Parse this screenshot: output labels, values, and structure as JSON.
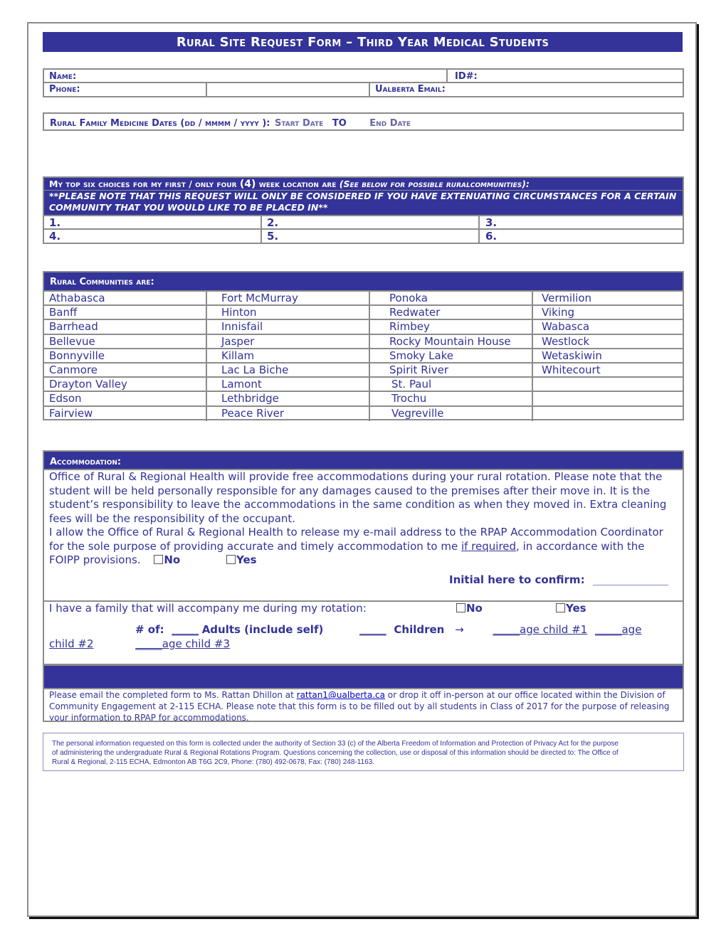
{
  "title": "Rural Site Request Form – Third Year Medical Students",
  "student_info": {
    "name_label": "Name:",
    "id_label": "ID#:",
    "phone_label": "Phone:",
    "email_label": "Ualberta Email:"
  },
  "dates": {
    "label": "Rural Family Medicine Dates (dd / mmmm / yyyy ):",
    "start_label": "Start Date",
    "to_label": "TO",
    "end_label": "End Date"
  },
  "choices": {
    "header_part1": "My top six choices for my first / only four",
    "header_num": "(4)",
    "header_part2": "week location are",
    "header_note": "(See below for possible ruralcommunities):",
    "note_line1": "**PLEASE NOTE THAT THIS REQUEST WILL ONLY BE CONSIDERED IF YOU HAVE EXTENUATING CIRCUMSTANCES FOR A CERTAIN",
    "note_line2": "COMMUNITY THAT YOU WOULD LIKE TO BE PLACED IN**",
    "slots": [
      "1.",
      "2.",
      "3.",
      "4.",
      "5.",
      "6."
    ]
  },
  "communities": {
    "header": "Rural Communities are:",
    "rows": [
      [
        "Athabasca",
        "Fort McMurray",
        "Ponoka",
        "Vermilion"
      ],
      [
        "Banff",
        "Hinton",
        "Redwater",
        "Viking"
      ],
      [
        "Barrhead",
        "Innisfail",
        "Rimbey",
        "Wabasca"
      ],
      [
        "Bellevue",
        "Jasper",
        "Rocky Mountain House",
        "Westlock"
      ],
      [
        "Bonnyville",
        "Killam",
        "Smoky Lake",
        "Wetaskiwin"
      ],
      [
        "Canmore",
        "Lac La Biche",
        "Spirit River",
        "Whitecourt"
      ],
      [
        "Drayton Valley",
        "Lamont",
        "St. Paul",
        ""
      ],
      [
        "Edson",
        "Lethbridge",
        "Trochu",
        ""
      ],
      [
        "Fairview",
        "Peace River",
        "Vegreville",
        ""
      ]
    ]
  },
  "accommodation": {
    "header": "Accommodation:",
    "lines": [
      "Office of Rural & Regional Health will provide free accommodations during your rural rotation. Please note that the",
      "student will be held personally responsible for any damages caused to the premises after their move in. It is the",
      "student’s responsibility to leave the accommodations in the same condition as when they moved in. Extra cleaning",
      "fees will be the responsibility of the occupant.",
      "I allow the Office of Rural & Regional Health to release my e-mail address to the RPAP Accommodation Coordinator"
    ],
    "line6_pre": "for the sole purpose of providing accurate and timely accommodation to me ",
    "line6_underline": "if required",
    "line6_post": ", in accordance with the",
    "line7": "FOIPP provisions.",
    "foipp_no": "No",
    "foipp_yes": "Yes",
    "initial_label": "Initial here to confirm:",
    "initial_blank": "______________",
    "family_label": "I have a family that will accompany me during my rotation:",
    "family_no": "No",
    "family_yes": "Yes",
    "num_of": "# of:",
    "adults_blank": "_____",
    "adults_label": "Adults (include self)",
    "children_blank": "_____",
    "children_label": "Children",
    "arrow": "→",
    "age1": "_____age child #1",
    "age2_part1": "_____age",
    "age2_part2": "child #2",
    "age3": "_____age child #3"
  },
  "submission": {
    "line1_pre": "Please email the completed form to Ms. Rattan Dhillon at ",
    "email": "rattan1@ualberta.ca",
    "line1_post": " or drop it off in-person at our office located within the Division of",
    "line2": "Community Engagement at 2-115 ECHA. Please note that this form is to be filled out by all students in Class of 2017 for the purpose of releasing",
    "line3": "your information to RPAP for accommodations."
  },
  "legal": {
    "line1": "The personal information requested on this form is collected under the authority of Section 33 (c) of the Alberta Freedom of Information and Protection of Privacy Act for the purpose",
    "line2": "of administering the undergraduate Rural & Regional Rotations Program.  Questions concerning the collection, use or disposal of this information should be directed to:  The Office of",
    "line3": "Rural & Regional, 2-115 ECHA, Edmonton AB T6G 2C9, Phone: (780) 492-0678, Fax: (780) 248-1163."
  },
  "colors": {
    "navy": "#333399",
    "border": "#8c8c8c",
    "link": "#0000cc"
  }
}
